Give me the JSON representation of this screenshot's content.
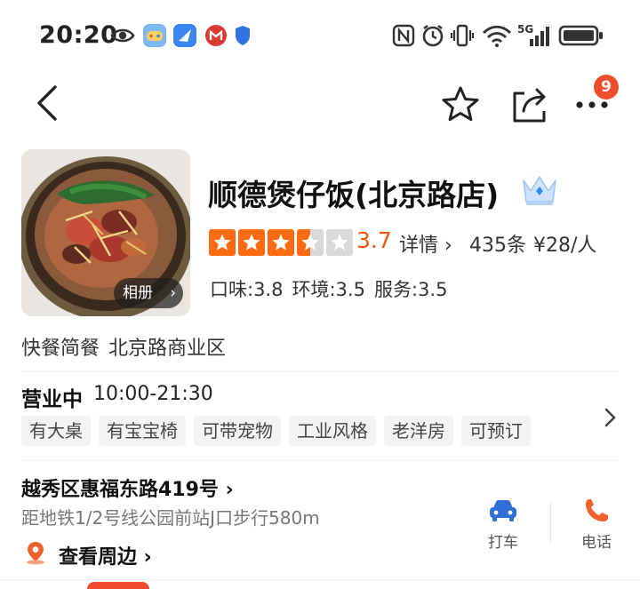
{
  "status_bar": {
    "time": "20:20",
    "left_icons": [
      "eye-icon",
      "game-app-icon",
      "feishu-app-icon",
      "bank-app-icon",
      "shield-icon"
    ],
    "right_icons": [
      "nfc-icon",
      "alarm-icon",
      "vibrate-icon",
      "wifi-icon",
      "signal-5g-icon",
      "battery-icon"
    ],
    "network_label": "5G"
  },
  "nav": {
    "back_icon": "back-chevron-icon",
    "favorite_icon": "star-outline-icon",
    "share_icon": "share-icon",
    "more_icon": "more-dots-icon",
    "more_badge_count": "9"
  },
  "shop": {
    "name": "顺德煲仔饭(北京路店)",
    "badge_icon": "crown-icon",
    "album_label": "相册",
    "rating_value": 3.5,
    "rating_text": "3.7",
    "detail_label": "详情",
    "review_count": "435条",
    "price": "¥28/人",
    "subscores": {
      "taste": "口味:3.8",
      "environment": "环境:3.5",
      "service": "服务:3.5"
    },
    "category": "快餐简餐",
    "area": "北京路商业区"
  },
  "business": {
    "status": "营业中",
    "hours": "10:00-21:30",
    "tags": [
      "有大桌",
      "有宝宝椅",
      "可带宠物",
      "工业风格",
      "老洋房",
      "可预订"
    ]
  },
  "location": {
    "address": "越秀区惠福东路419号",
    "metro": "距地铁1/2号线公园前站J口步行580m",
    "nearby_label": "查看周边",
    "taxi_label": "打车",
    "phone_label": "电话"
  },
  "colors": {
    "accent_orange": "#f4540b",
    "star_orange": "#ff6a13",
    "star_empty": "#d9d9d9",
    "taxi_blue": "#2f6fd6",
    "phone_orange": "#f0612b",
    "badge_red": "#ef4d2b"
  }
}
